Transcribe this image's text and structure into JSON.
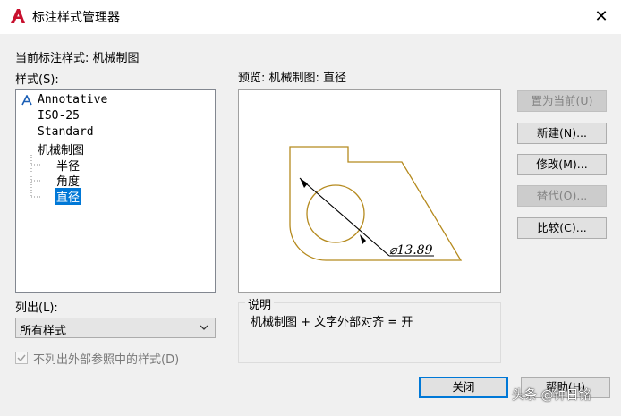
{
  "window": {
    "title": "标注样式管理器",
    "close_glyph": "✕"
  },
  "current_style": {
    "label": "当前标注样式: 机械制图"
  },
  "styles_list": {
    "label": "样式(S):",
    "items": [
      "Annotative",
      "ISO-25",
      "Standard",
      "机械制图"
    ],
    "children": [
      "半径",
      "角度",
      "直径"
    ],
    "selected": "直径"
  },
  "list_filter": {
    "label": "列出(L):",
    "selected": "所有样式"
  },
  "xref_checkbox": {
    "label": "不列出外部参照中的样式(D)",
    "checked": true,
    "disabled": true
  },
  "preview": {
    "label": "预览: 机械制图: 直径",
    "dimension_text": "⌀13.89"
  },
  "description": {
    "label": "说明",
    "text": "机械制图 + 文字外部对齐 = 开"
  },
  "buttons": {
    "set_current": "置为当前(U)",
    "new": "新建(N)...",
    "modify": "修改(M)...",
    "override": "替代(O)...",
    "compare": "比较(C)...",
    "close": "关闭",
    "help": "帮助(H)"
  },
  "watermark": "头条 @钟日铭",
  "colors": {
    "accent": "#0078d7",
    "preview_geometry": "#b58a1e",
    "app_icon": "#c8102e"
  }
}
